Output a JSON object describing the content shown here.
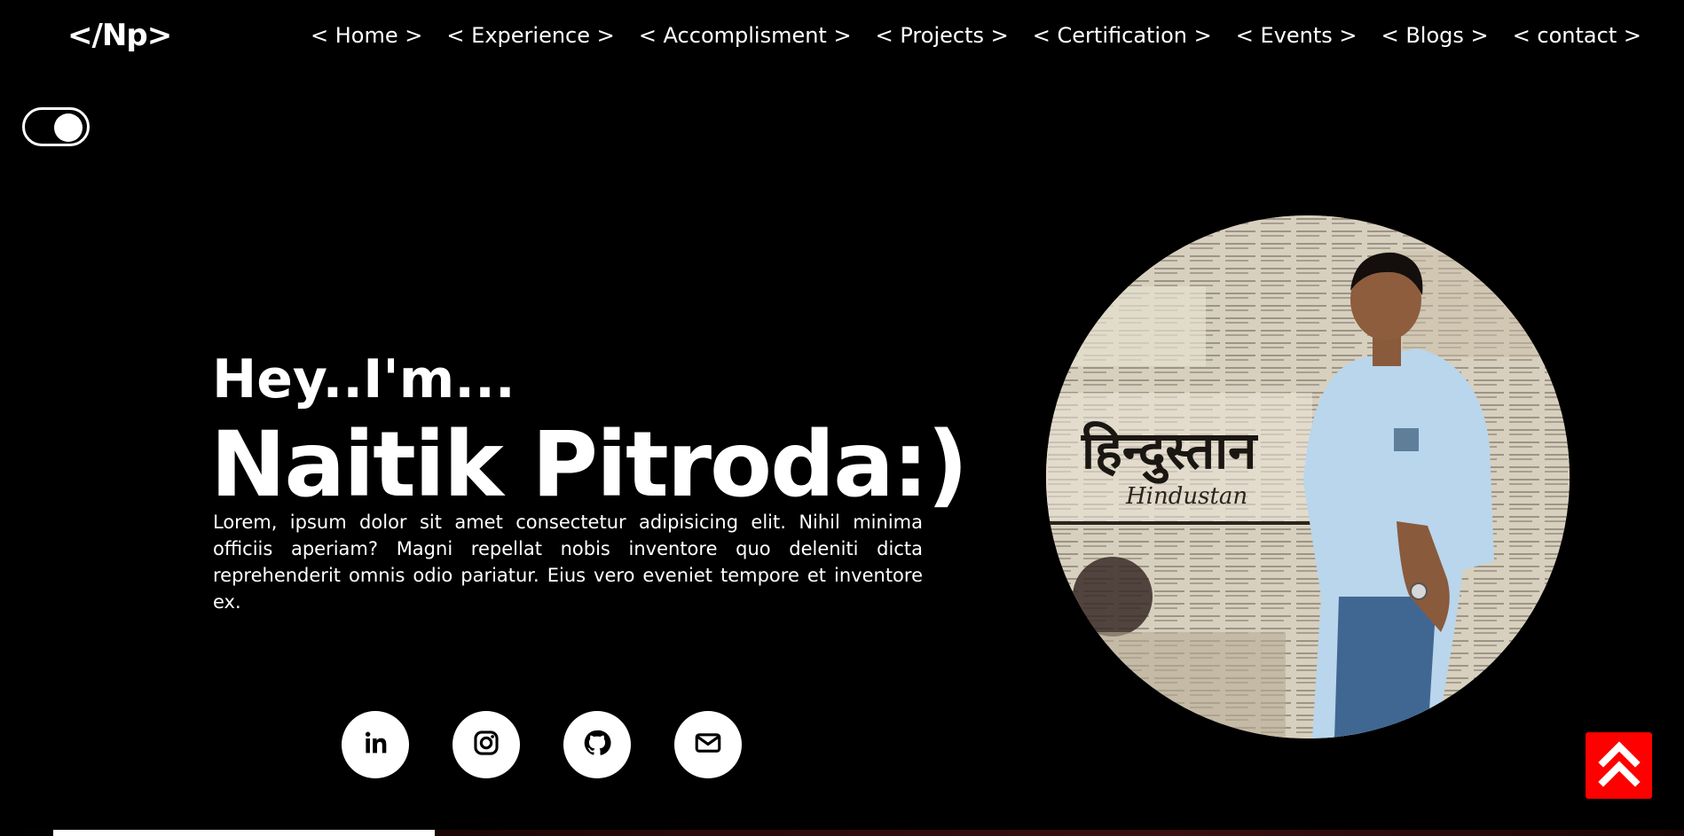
{
  "header": {
    "logo_text": "</Np>",
    "nav": [
      {
        "label": "< Home >"
      },
      {
        "label": "< Experience >"
      },
      {
        "label": "< Accomplisment >"
      },
      {
        "label": "< Projects >"
      },
      {
        "label": "< Certification >"
      },
      {
        "label": "< Events >"
      },
      {
        "label": "< Blogs >"
      },
      {
        "label": "< contact >"
      }
    ]
  },
  "theme_toggle": {
    "icon": "toggle-switch-icon",
    "state": "on"
  },
  "hero": {
    "greeting": "Hey..I'm...",
    "name": "Naitik Pitroda:)",
    "bio": "Lorem, ipsum dolor sit amet consectetur adipisicing elit. Nihil minima officiis aperiam? Magni repellat nobis inventore quo deleniti dicta reprehenderit omnis odio pariatur. Eius vero eveniet tempore et inventore ex."
  },
  "social": [
    {
      "icon": "linkedin-icon"
    },
    {
      "icon": "instagram-icon"
    },
    {
      "icon": "github-icon"
    },
    {
      "icon": "mail-icon"
    }
  ],
  "scroll_top": {
    "icon": "double-chevron-up-icon",
    "color": "#ff0000"
  },
  "scroll_progress": 0.23,
  "colors": {
    "background": "#000000",
    "text": "#ffffff",
    "accent": "#ff0000"
  }
}
